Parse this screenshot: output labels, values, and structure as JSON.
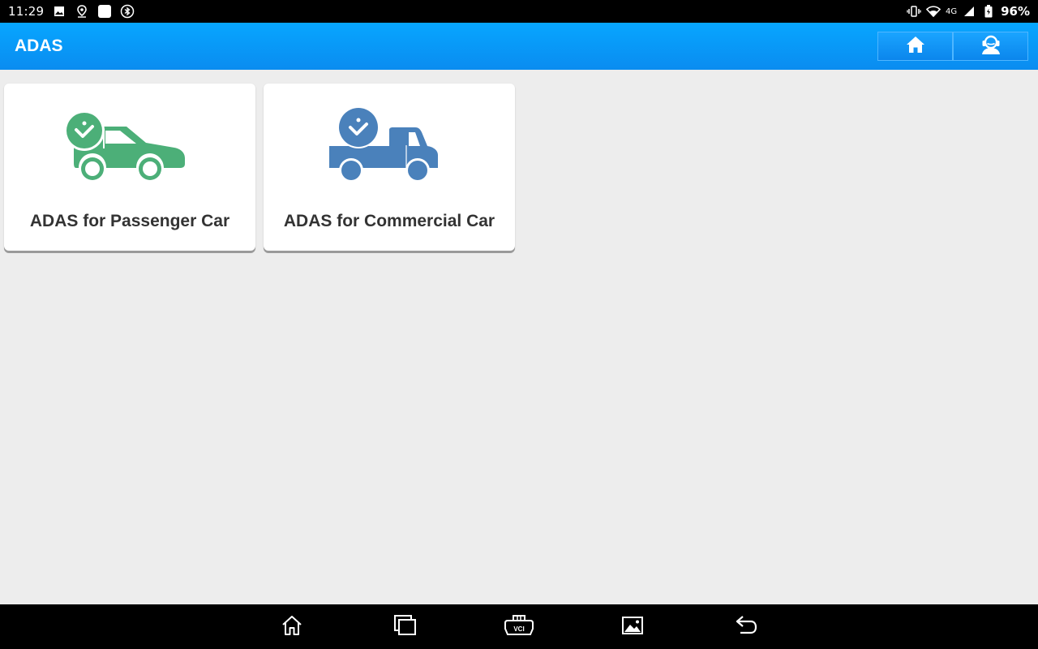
{
  "status_bar": {
    "time": "11:29",
    "network": "4G",
    "battery": "96%",
    "left_icons": [
      "image-icon",
      "location-pin-icon",
      "app-square-icon",
      "bluetooth-icon"
    ],
    "right_icons": [
      "vibrate-icon",
      "wifi-icon",
      "signal-icon",
      "battery-icon"
    ]
  },
  "header": {
    "title": "ADAS",
    "buttons": [
      {
        "name": "home-button",
        "icon": "home-icon"
      },
      {
        "name": "support-button",
        "icon": "headset-support-icon"
      }
    ],
    "color": "#0a9cf5"
  },
  "cards": [
    {
      "label": "ADAS for Passenger Car",
      "icon": "passenger-car-check-icon",
      "color": "#4caf78"
    },
    {
      "label": "ADAS for Commercial Car",
      "icon": "commercial-truck-check-icon",
      "color": "#4a81bb"
    }
  ],
  "nav_bar": {
    "buttons": [
      {
        "name": "nav-home-button",
        "icon": "home-outline-icon"
      },
      {
        "name": "nav-recent-button",
        "icon": "recent-apps-icon"
      },
      {
        "name": "nav-vci-button",
        "icon": "vci-connector-icon",
        "text": "VCI"
      },
      {
        "name": "nav-screenshot-button",
        "icon": "gallery-icon"
      },
      {
        "name": "nav-back-button",
        "icon": "back-arrow-icon"
      }
    ]
  }
}
